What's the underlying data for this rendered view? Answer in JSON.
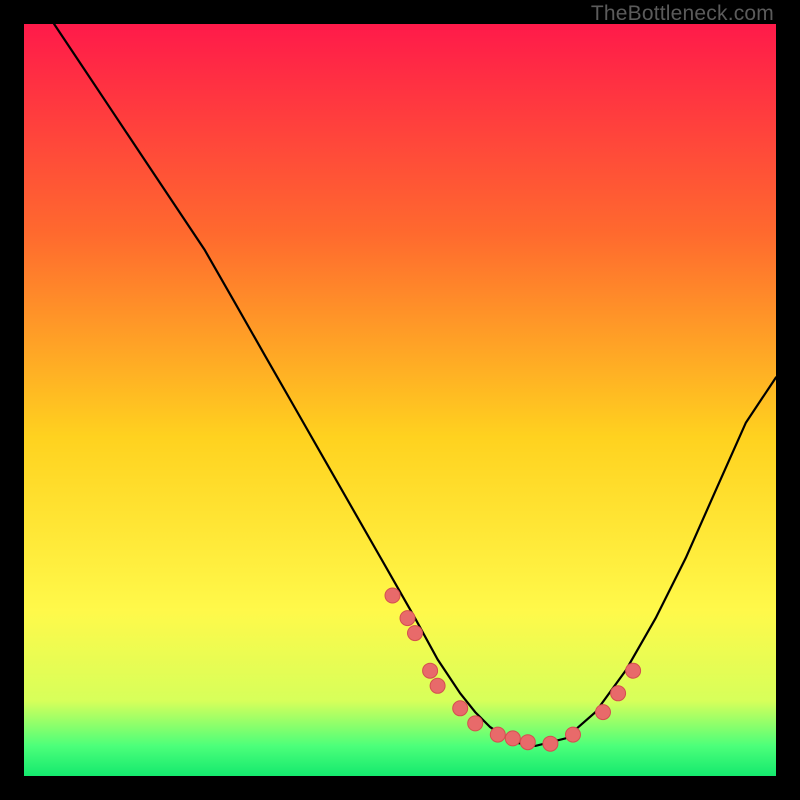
{
  "watermark": "TheBottleneck.com",
  "colors": {
    "background": "#000000",
    "gradient_top": "#ff1a4a",
    "gradient_mid1": "#ff6a2e",
    "gradient_mid2": "#ffd21f",
    "gradient_mid3": "#fff94a",
    "gradient_bottom1": "#d7ff5a",
    "gradient_bottom2": "#4cff7a",
    "gradient_bottom3": "#14e96e",
    "curve": "#000000",
    "marker_fill": "#e86a6a",
    "marker_stroke": "#d44f4f"
  },
  "chart_data": {
    "type": "line",
    "title": "",
    "xlabel": "",
    "ylabel": "",
    "xlim": [
      0,
      100
    ],
    "ylim": [
      0,
      100
    ],
    "series": [
      {
        "name": "bottleneck-curve",
        "x": [
          4,
          8,
          12,
          16,
          20,
          24,
          28,
          32,
          36,
          40,
          44,
          48,
          52,
          55,
          58,
          60,
          62,
          65,
          68,
          72,
          76,
          80,
          84,
          88,
          92,
          96,
          100
        ],
        "y": [
          100,
          94,
          88,
          82,
          76,
          70,
          63,
          56,
          49,
          42,
          35,
          28,
          21,
          15.5,
          11,
          8.5,
          6.5,
          4.5,
          4,
          5,
          8.5,
          14,
          21,
          29,
          38,
          47,
          53
        ]
      }
    ],
    "markers": {
      "name": "highlighted-points",
      "x": [
        49,
        51,
        52,
        54,
        55,
        58,
        60,
        63,
        65,
        67,
        70,
        73,
        77,
        79,
        81
      ],
      "y": [
        24,
        21,
        19,
        14,
        12,
        9,
        7,
        5.5,
        5,
        4.5,
        4.3,
        5.5,
        8.5,
        11,
        14
      ]
    }
  }
}
